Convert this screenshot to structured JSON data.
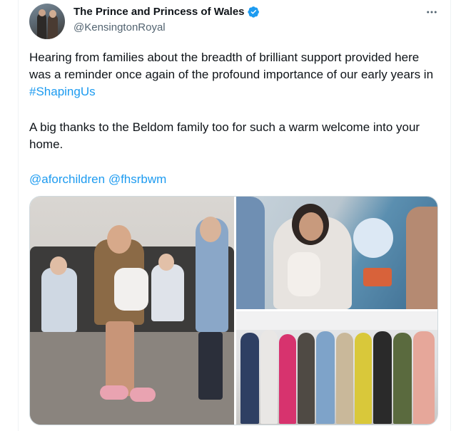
{
  "author": {
    "display_name": "The Prince and Princess of Wales",
    "handle": "@KensingtonRoyal",
    "verified": true
  },
  "icons": {
    "verified": "verified-badge-icon",
    "more": "more-options-icon"
  },
  "post": {
    "paragraph1_text": "Hearing from families about the breadth of brilliant support provided here was a reminder once again of the profound importance of our early years in ",
    "paragraph1_hashtag": "#ShapingUs",
    "paragraph2": "A big thanks to the Beldom family too for such a warm welcome into your home.",
    "mention1": "@aforchildren",
    "mention2": "@fhsrbwm"
  },
  "colors": {
    "link": "#1d9bf0",
    "verified": "#1d9bf0",
    "secondary_text": "#536471"
  },
  "media": {
    "count": 3
  }
}
